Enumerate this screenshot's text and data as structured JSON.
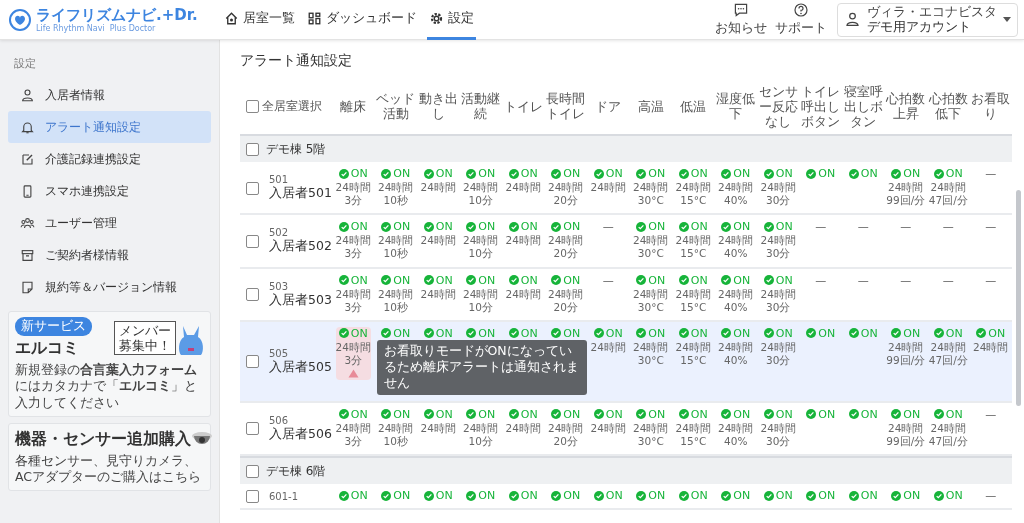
{
  "header": {
    "logo": {
      "title": "ライフリズムナビ.+Dr.",
      "subtitle": "Life Rhythm Navi  Plus Doctor"
    },
    "nav": [
      {
        "label": "居室一覧",
        "selected": false
      },
      {
        "label": "ダッシュボード",
        "selected": false
      },
      {
        "label": "設定",
        "selected": true
      }
    ],
    "actions": [
      {
        "label": "お知らせ"
      },
      {
        "label": "サポート"
      }
    ],
    "account": {
      "facility": "ヴィラ・エコナビスタ",
      "name": "デモ用アカウント"
    }
  },
  "sidebar": {
    "heading": "設定",
    "items": [
      {
        "label": "入居者情報",
        "selected": false
      },
      {
        "label": "アラート通知設定",
        "selected": true
      },
      {
        "label": "介護記録連携設定",
        "selected": false
      },
      {
        "label": "スマホ連携設定",
        "selected": false
      },
      {
        "label": "ユーザー管理",
        "selected": false
      },
      {
        "label": "ご契約者様情報",
        "selected": false
      },
      {
        "label": "規約等＆バージョン情報",
        "selected": false
      }
    ],
    "banners": [
      {
        "kind": "service",
        "badge": "新サービス",
        "title": "エルコミ",
        "text": "新規登録の**合言葉入力フォーム**にはカタカナで「**エルコミ**」と入力してください",
        "sign": "メンバー募集中！"
      },
      {
        "kind": "purchase",
        "title": "機器・センサー追加購入",
        "text": "各種センサー、見守りカメラ、ACアダプターのご購入はこちら"
      }
    ]
  },
  "page_title": "アラート通知設定",
  "table": {
    "select_all": {
      "label": "全居室選択",
      "checked": false
    },
    "columns": [
      "離床",
      "ベッド活動",
      "動き出し",
      "活動継続",
      "トイレ",
      "長時間トイレ",
      "ドア",
      "高温",
      "低温",
      "湿度低下",
      "センサー反応なし",
      "トイレ呼出しボタン",
      "寝室呼出しボタン",
      "心拍数上昇",
      "心拍数低下",
      "お看取り"
    ],
    "groups": [
      {
        "name": "デモ棟 5階",
        "checked": false,
        "rows": [
          {
            "number": "501",
            "name": "入居者501",
            "checked": false,
            "cells": [
              {
                "kind": "on",
                "label": "ON",
                "sub": "24時間\n3分"
              },
              {
                "kind": "on",
                "label": "ON",
                "sub": "24時間\n10秒"
              },
              {
                "kind": "on",
                "label": "ON",
                "sub": "24時間"
              },
              {
                "kind": "on",
                "label": "ON",
                "sub": "24時間\n10分"
              },
              {
                "kind": "on",
                "label": "ON",
                "sub": "24時間"
              },
              {
                "kind": "on",
                "label": "ON",
                "sub": "24時間\n20分"
              },
              {
                "kind": "on",
                "label": "ON",
                "sub": "24時間"
              },
              {
                "kind": "on",
                "label": "ON",
                "sub": "24時間\n30°C"
              },
              {
                "kind": "on",
                "label": "ON",
                "sub": "24時間\n15°C"
              },
              {
                "kind": "on",
                "label": "ON",
                "sub": "24時間\n40%"
              },
              {
                "kind": "on",
                "label": "ON",
                "sub": "24時間\n30分"
              },
              {
                "kind": "on",
                "label": "ON"
              },
              {
                "kind": "on",
                "label": "ON"
              },
              {
                "kind": "on",
                "label": "ON",
                "sub": "24時間\n99回/分"
              },
              {
                "kind": "on",
                "label": "ON",
                "sub": "24時間\n47回/分"
              },
              {
                "kind": "none",
                "text": "—"
              }
            ]
          },
          {
            "number": "502",
            "name": "入居者502",
            "checked": false,
            "cells": [
              {
                "kind": "on",
                "label": "ON",
                "sub": "24時間\n3分"
              },
              {
                "kind": "on",
                "label": "ON",
                "sub": "24時間\n10秒"
              },
              {
                "kind": "on",
                "label": "ON",
                "sub": "24時間"
              },
              {
                "kind": "on",
                "label": "ON",
                "sub": "24時間\n10分"
              },
              {
                "kind": "on",
                "label": "ON",
                "sub": "24時間"
              },
              {
                "kind": "on",
                "label": "ON",
                "sub": "24時間\n20分"
              },
              {
                "kind": "none",
                "text": "—"
              },
              {
                "kind": "on",
                "label": "ON",
                "sub": "24時間\n30°C"
              },
              {
                "kind": "on",
                "label": "ON",
                "sub": "24時間\n15°C"
              },
              {
                "kind": "on",
                "label": "ON",
                "sub": "24時間\n40%"
              },
              {
                "kind": "on",
                "label": "ON",
                "sub": "24時間\n30分"
              },
              {
                "kind": "none",
                "text": "—"
              },
              {
                "kind": "none",
                "text": "—"
              },
              {
                "kind": "none",
                "text": "—"
              },
              {
                "kind": "none",
                "text": "—"
              },
              {
                "kind": "none",
                "text": "—"
              }
            ]
          },
          {
            "number": "503",
            "name": "入居者503",
            "checked": false,
            "cells": [
              {
                "kind": "on",
                "label": "ON",
                "sub": "24時間\n3分"
              },
              {
                "kind": "on",
                "label": "ON",
                "sub": "24時間\n10秒"
              },
              {
                "kind": "on",
                "label": "ON",
                "sub": "24時間"
              },
              {
                "kind": "on",
                "label": "ON",
                "sub": "24時間\n10分"
              },
              {
                "kind": "on",
                "label": "ON",
                "sub": "24時間"
              },
              {
                "kind": "on",
                "label": "ON",
                "sub": "24時間\n20分"
              },
              {
                "kind": "none",
                "text": "—"
              },
              {
                "kind": "on",
                "label": "ON",
                "sub": "24時間\n30°C"
              },
              {
                "kind": "on",
                "label": "ON",
                "sub": "24時間\n15°C"
              },
              {
                "kind": "on",
                "label": "ON",
                "sub": "24時間\n40%"
              },
              {
                "kind": "on",
                "label": "ON",
                "sub": "24時間\n30分"
              },
              {
                "kind": "none",
                "text": "—"
              },
              {
                "kind": "none",
                "text": "—"
              },
              {
                "kind": "none",
                "text": "—"
              },
              {
                "kind": "none",
                "text": "—"
              },
              {
                "kind": "none",
                "text": "—"
              }
            ]
          },
          {
            "number": "505",
            "name": "入居者505",
            "checked": false,
            "highlighted": true,
            "tooltip": "お看取りモードがONになっているため離床アラートは通知されません",
            "cells": [
              {
                "kind": "on",
                "label": "ON",
                "sub": "24時間\n3分",
                "warning": true
              },
              {
                "kind": "on",
                "label": "ON"
              },
              {
                "kind": "on",
                "label": "ON"
              },
              {
                "kind": "on",
                "label": "ON"
              },
              {
                "kind": "on",
                "label": "ON"
              },
              {
                "kind": "on",
                "label": "ON"
              },
              {
                "kind": "on",
                "label": "ON",
                "sub": "24時間"
              },
              {
                "kind": "on",
                "label": "ON",
                "sub": "24時間\n30°C"
              },
              {
                "kind": "on",
                "label": "ON",
                "sub": "24時間\n15°C"
              },
              {
                "kind": "on",
                "label": "ON",
                "sub": "24時間\n40%"
              },
              {
                "kind": "on",
                "label": "ON",
                "sub": "24時間\n30分"
              },
              {
                "kind": "on",
                "label": "ON"
              },
              {
                "kind": "on",
                "label": "ON"
              },
              {
                "kind": "on",
                "label": "ON",
                "sub": "24時間\n99回/分"
              },
              {
                "kind": "on",
                "label": "ON",
                "sub": "24時間\n47回/分"
              },
              {
                "kind": "on",
                "label": "ON",
                "sub": "24時間"
              }
            ]
          },
          {
            "number": "506",
            "name": "入居者506",
            "checked": false,
            "cells": [
              {
                "kind": "on",
                "label": "ON",
                "sub": "24時間\n3分"
              },
              {
                "kind": "on",
                "label": "ON",
                "sub": "24時間\n10秒"
              },
              {
                "kind": "on",
                "label": "ON",
                "sub": "24時間"
              },
              {
                "kind": "on",
                "label": "ON",
                "sub": "24時間\n10分"
              },
              {
                "kind": "on",
                "label": "ON",
                "sub": "24時間"
              },
              {
                "kind": "on",
                "label": "ON",
                "sub": "24時間\n20分"
              },
              {
                "kind": "on",
                "label": "ON",
                "sub": "24時間"
              },
              {
                "kind": "on",
                "label": "ON",
                "sub": "24時間\n30°C"
              },
              {
                "kind": "on",
                "label": "ON",
                "sub": "24時間\n15°C"
              },
              {
                "kind": "on",
                "label": "ON",
                "sub": "24時間\n40%"
              },
              {
                "kind": "on",
                "label": "ON",
                "sub": "24時間\n30分"
              },
              {
                "kind": "on",
                "label": "ON"
              },
              {
                "kind": "on",
                "label": "ON"
              },
              {
                "kind": "on",
                "label": "ON",
                "sub": "24時間\n99回/分"
              },
              {
                "kind": "on",
                "label": "ON",
                "sub": "24時間\n47回/分"
              },
              {
                "kind": "none",
                "text": "—"
              }
            ]
          }
        ]
      },
      {
        "name": "デモ棟 6階",
        "checked": false,
        "rows": [
          {
            "number": "601-1",
            "checked": false,
            "cells": [
              {
                "kind": "on",
                "label": "ON"
              },
              {
                "kind": "on",
                "label": "ON"
              },
              {
                "kind": "on",
                "label": "ON"
              },
              {
                "kind": "on",
                "label": "ON"
              },
              {
                "kind": "on",
                "label": "ON"
              },
              {
                "kind": "on",
                "label": "ON"
              },
              {
                "kind": "on",
                "label": "ON"
              },
              {
                "kind": "on",
                "label": "ON"
              },
              {
                "kind": "on",
                "label": "ON"
              },
              {
                "kind": "on",
                "label": "ON"
              },
              {
                "kind": "on",
                "label": "ON"
              },
              {
                "kind": "on",
                "label": "ON"
              },
              {
                "kind": "on",
                "label": "ON"
              },
              {
                "kind": "on",
                "label": "ON"
              },
              {
                "kind": "on",
                "label": "ON"
              },
              {
                "kind": "none",
                "text": "—"
              }
            ]
          }
        ]
      }
    ]
  }
}
